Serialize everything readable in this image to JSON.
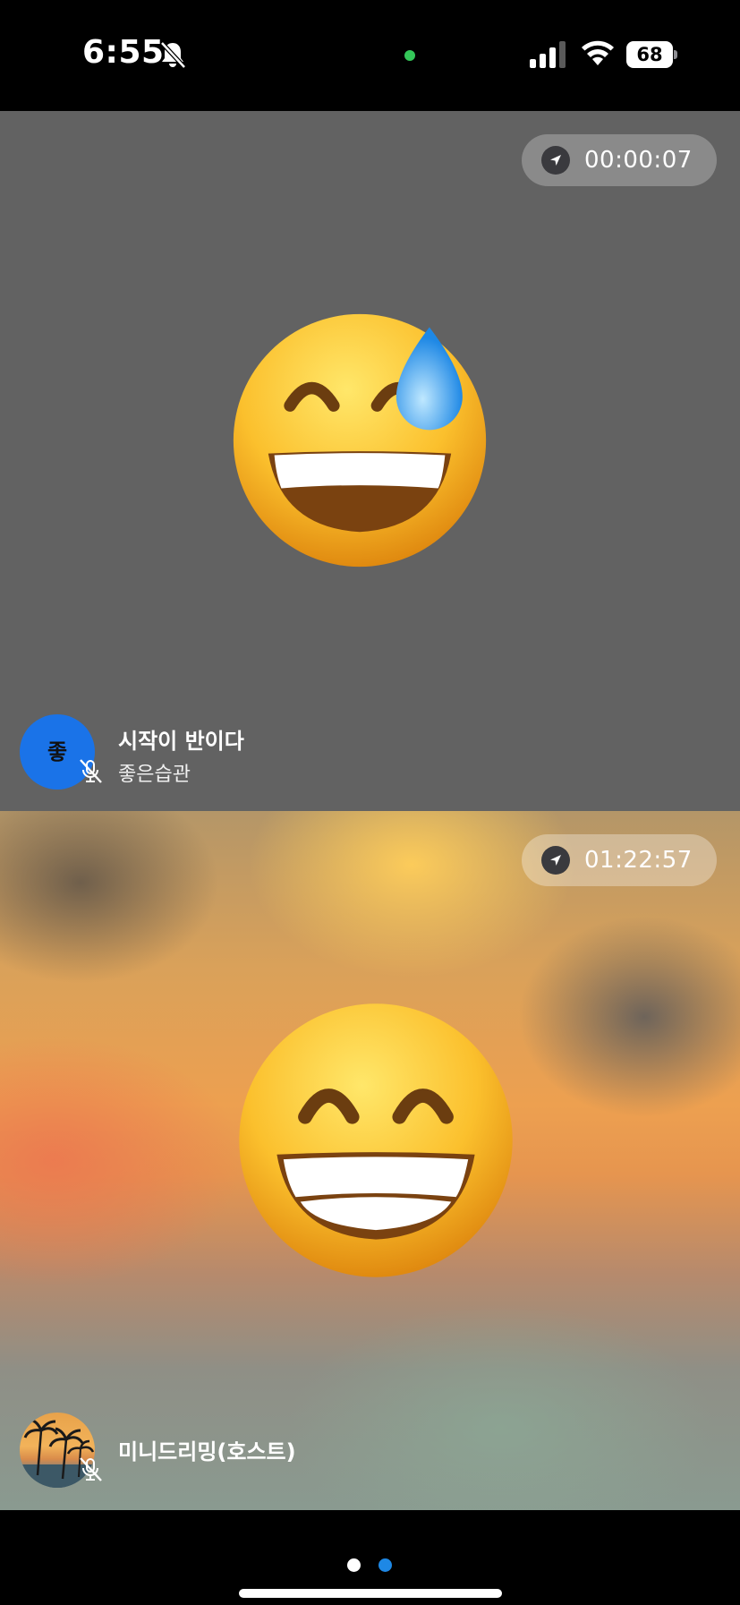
{
  "status_bar": {
    "time": "6:55",
    "battery": "68",
    "icons": [
      "bell-slash-icon",
      "green-dot-indicator",
      "signal-icon",
      "wifi-icon",
      "battery-icon"
    ]
  },
  "tiles": [
    {
      "timer": "00:00:07",
      "emoji_icon": "grinning-face-with-sweat-icon",
      "avatar_letter": "좋",
      "name": "시작이 반이다",
      "subname": "좋은습관",
      "mic": "muted"
    },
    {
      "timer": "01:22:57",
      "emoji_icon": "beaming-face-with-smiling-eyes-icon",
      "avatar_image": "palm-tree-sunset-avatar",
      "name": "미니드리밍(호스트)",
      "mic": "muted"
    }
  ],
  "pager": {
    "page_count": 2,
    "active_page": 2
  },
  "colors": {
    "avatar_blue": "#1a73e8",
    "active_dot": "#1e88e5",
    "tile_gray": "#626262"
  }
}
